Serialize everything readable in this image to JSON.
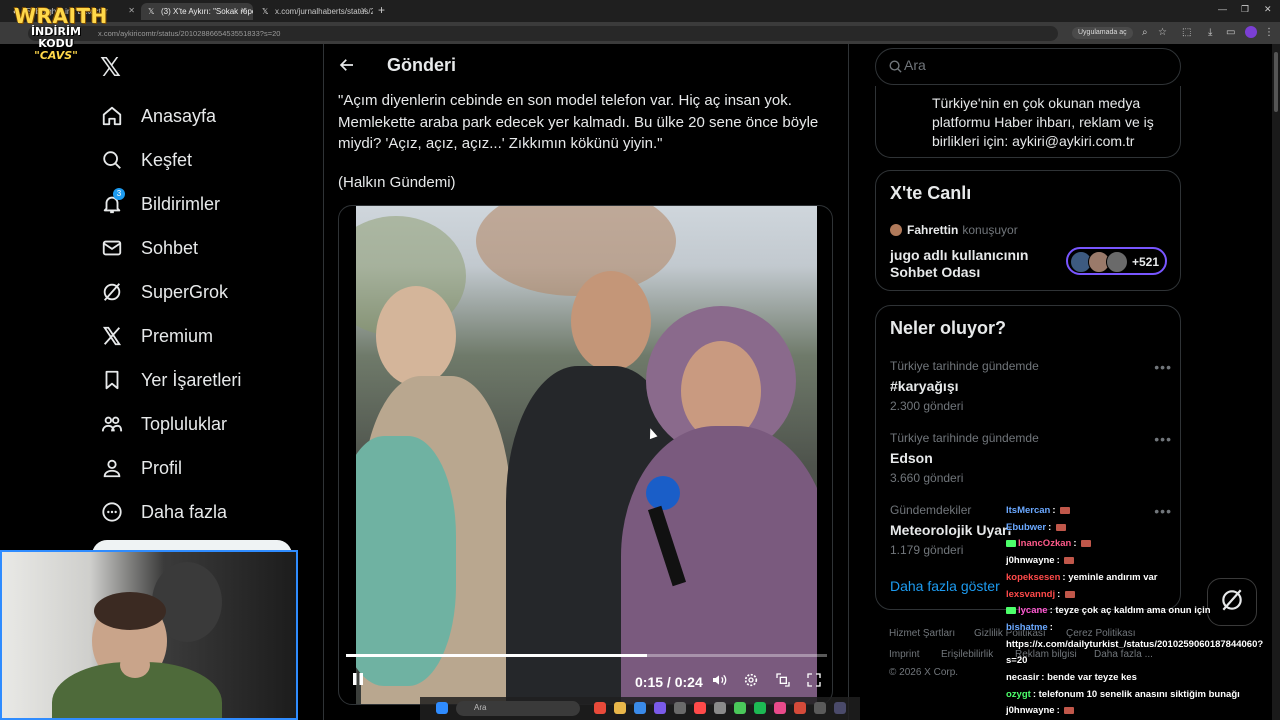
{
  "browser": {
    "tabs": [
      {
        "title": "SubSight Link Detector"
      },
      {
        "title": "(3) X'te Aykırı: \"Sokak röpo"
      },
      {
        "title": "x.com/jurnalhaberts/status/20"
      }
    ],
    "url": "x.com/aykiricomtr/status/2010288665453551833?s=20",
    "open_in_app": "Uygulamada aç"
  },
  "overlay_logo": {
    "line1": "WRAITH",
    "line2": "İNDİRİM KODU",
    "line3": "\"CAVS\""
  },
  "nav": {
    "items": [
      {
        "label": "Anasayfa",
        "icon": "home-icon"
      },
      {
        "label": "Keşfet",
        "icon": "search-icon"
      },
      {
        "label": "Bildirimler",
        "icon": "bell-icon",
        "badge": "3"
      },
      {
        "label": "Sohbet",
        "icon": "mail-icon"
      },
      {
        "label": "SuperGrok",
        "icon": "grok-icon"
      },
      {
        "label": "Premium",
        "icon": "x-icon"
      },
      {
        "label": "Yer İşaretleri",
        "icon": "bookmark-icon"
      },
      {
        "label": "Topluluklar",
        "icon": "communities-icon"
      },
      {
        "label": "Profil",
        "icon": "profile-icon"
      },
      {
        "label": "Daha fazla",
        "icon": "more-circle-icon"
      }
    ]
  },
  "post": {
    "header_title": "Gönderi",
    "text": "\"Açım diyenlerin cebinde en son model telefon var. Hiç aç insan yok. Memlekette araba park edecek yer kalmadı. Bu ülke 20 sene önce böyle miydi? 'Açız, açız, açız...' Zıkkımın kökünü yiyin.\"",
    "source": "(Halkın Gündemi)",
    "video": {
      "current_time": "0:15",
      "duration": "0:24",
      "progress": 0.625
    }
  },
  "sidebar": {
    "search_placeholder": "Ara",
    "bio": "Türkiye'nin en çok okunan medya platformu Haber ihbarı, reklam ve iş birlikleri için: aykiri@aykiri.com.tr",
    "live": {
      "title": "X'te Canlı",
      "host": "Fahrettin",
      "host_status": "konuşuyor",
      "space_title": "jugo adlı kullanıcının Sohbet Odası",
      "listener_count": "+521"
    },
    "trends": {
      "title": "Neler oluyor?",
      "items": [
        {
          "context": "Türkiye tarihinde gündemde",
          "name": "#karyağışı",
          "count": "2.300 gönderi"
        },
        {
          "context": "Türkiye tarihinde gündemde",
          "name": "Edson",
          "count": "3.660 gönderi"
        },
        {
          "context": "Gündemdekiler",
          "name": "Meteorolojik Uyarı",
          "count": "1.179 gönderi"
        }
      ],
      "show_more": "Daha fazla göster"
    },
    "footer": {
      "links": [
        "Hizmet Şartları",
        "Gizlilik Politikası",
        "Çerez Politikası",
        "Imprint",
        "Erişilebilirlik",
        "Reklam bilgisi",
        "Daha fazla ..."
      ],
      "copyright": "© 2026 X Corp."
    }
  },
  "chat": [
    {
      "user": "ItsMercan",
      "color": "#6aa8ff",
      "msg": ""
    },
    {
      "user": "Ebubwer",
      "color": "#6aa8ff",
      "msg": ""
    },
    {
      "user": "InancOzkan",
      "color": "#ff5a8a",
      "msg": ""
    },
    {
      "user": "j0hnwayne",
      "color": "#ffffff",
      "msg": ""
    },
    {
      "user": "kopeksesen",
      "color": "#ff4a4a",
      "msg": "yeminle andırım var"
    },
    {
      "user": "lexsvanndj",
      "color": "#ff4a4a",
      "msg": ""
    },
    {
      "user": "lycane",
      "color": "#ff5ad2",
      "msg": "teyze çok aç kaldım ama onun için"
    },
    {
      "user": "bishatme",
      "color": "#6aa8ff",
      "msg": ""
    },
    {
      "user": "",
      "color": "#ffffff",
      "msg": "https://x.com/dailyturkist_/status/2010259060187844060?"
    },
    {
      "user": "",
      "color": "#ffffff",
      "msg": "s=20"
    },
    {
      "user": "necasir",
      "color": "#ffffff",
      "msg": "bende var teyze kes"
    },
    {
      "user": "ozygt",
      "color": "#4cff6a",
      "msg": "telefonum 10 senelik anasını siktiğim bunağı"
    },
    {
      "user": "j0hnwayne",
      "color": "#ffffff",
      "msg": ""
    }
  ],
  "taskbar": {
    "search_placeholder": "Ara"
  },
  "colors": {
    "accent": "#1d9bf0",
    "live_border": "#7856ff",
    "webcam_border": "#2f8cff"
  }
}
